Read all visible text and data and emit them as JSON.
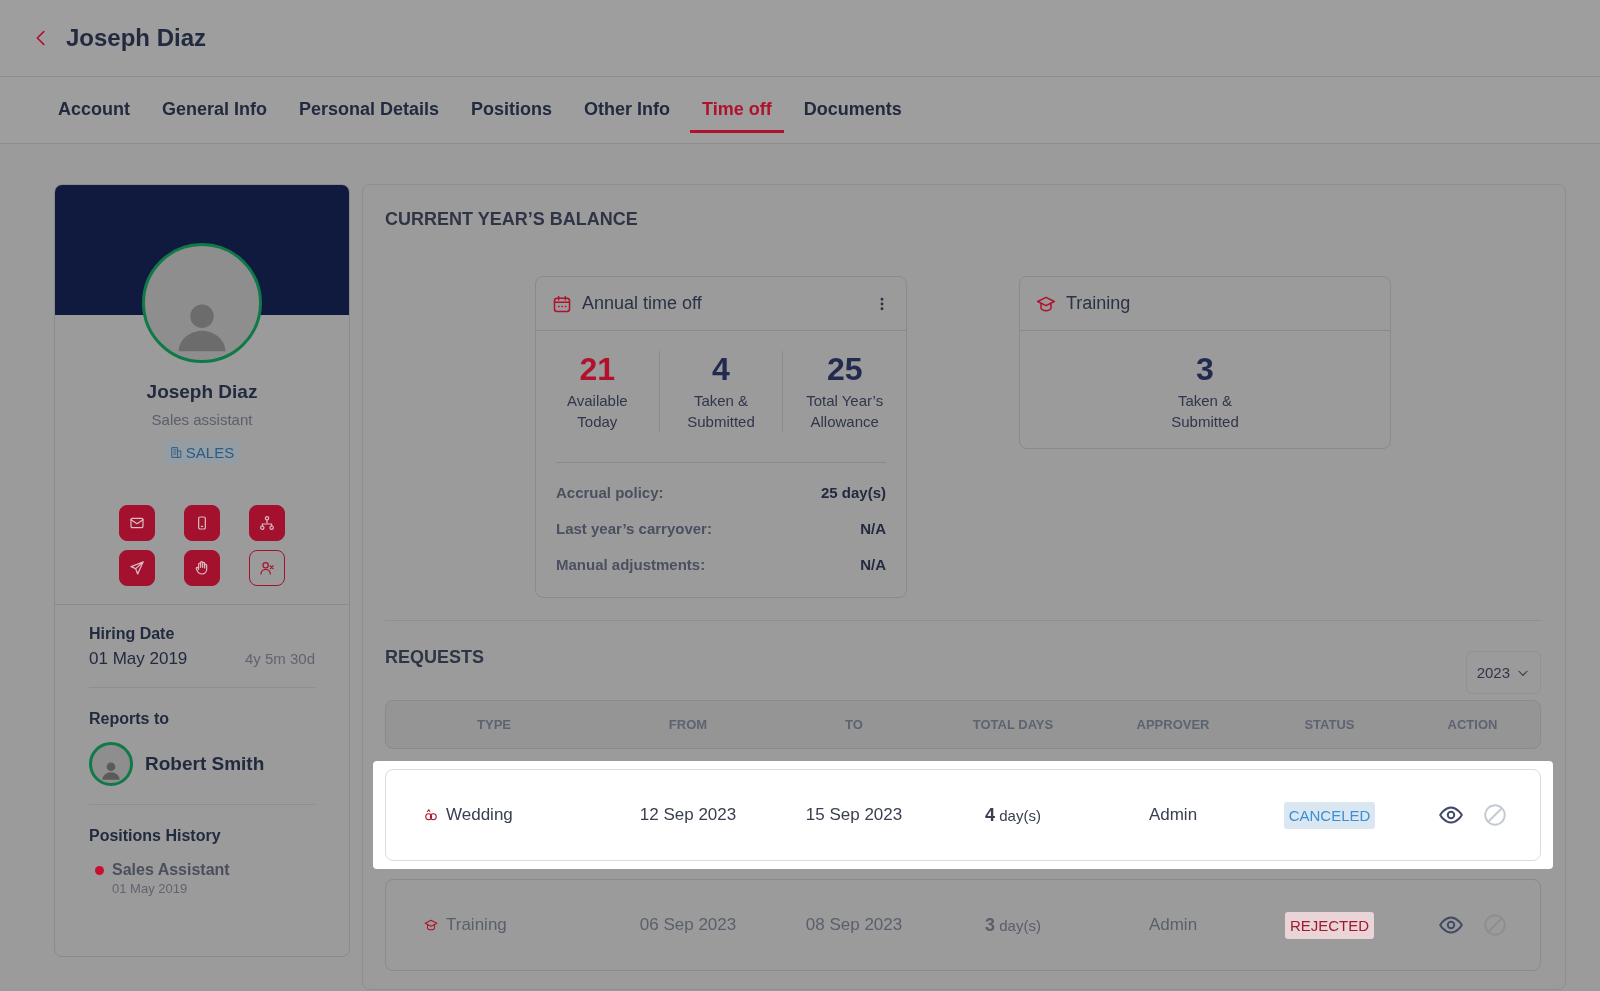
{
  "header": {
    "title": "Joseph Diaz"
  },
  "tabs": [
    {
      "label": "Account",
      "selected": false
    },
    {
      "label": "General Info",
      "selected": false
    },
    {
      "label": "Personal Details",
      "selected": false
    },
    {
      "label": "Positions",
      "selected": false
    },
    {
      "label": "Other Info",
      "selected": false
    },
    {
      "label": "Time off",
      "selected": true
    },
    {
      "label": "Documents",
      "selected": false
    }
  ],
  "profile": {
    "name": "Joseph Diaz",
    "role": "Sales assistant",
    "department": "SALES",
    "actions": [
      {
        "kind": "mail",
        "filled": true
      },
      {
        "kind": "phone",
        "filled": true
      },
      {
        "kind": "org",
        "filled": true
      },
      {
        "kind": "send",
        "filled": true
      },
      {
        "kind": "hand",
        "filled": true
      },
      {
        "kind": "user-remove",
        "filled": false
      }
    ],
    "hiring_label": "Hiring Date",
    "hiring_date": "01 May 2019",
    "tenure": "4y 5m 30d",
    "reports_label": "Reports to",
    "manager": "Robert Smith",
    "history_label": "Positions History",
    "history": [
      {
        "title": "Sales Assistant",
        "date": "01 May 2019",
        "color": "#c8102e"
      }
    ]
  },
  "balance": {
    "title": "CURRENT YEAR’S BALANCE",
    "cards": [
      {
        "kind": "annual",
        "title": "Annual time off",
        "menu": true,
        "stats": [
          {
            "value": "21",
            "label": "Available Today",
            "highlight": true
          },
          {
            "value": "4",
            "label": "Taken & Submitted",
            "highlight": false
          },
          {
            "value": "25",
            "label": "Total Year’s Allowance",
            "highlight": false
          }
        ],
        "details": [
          {
            "label": "Accrual policy:",
            "value": "25 day(s)"
          },
          {
            "label": "Last year’s carryover:",
            "value": "N/A"
          },
          {
            "label": "Manual adjustments:",
            "value": "N/A"
          }
        ]
      },
      {
        "kind": "training",
        "title": "Training",
        "menu": false,
        "stats": [
          {
            "value": "3",
            "label": "Taken & Submitted",
            "highlight": false
          }
        ]
      }
    ]
  },
  "requests": {
    "title": "REQUESTS",
    "year": "2023",
    "columns": [
      "TYPE",
      "FROM",
      "TO",
      "TOTAL DAYS",
      "APPROVER",
      "STATUS",
      "ACTION"
    ],
    "rows": [
      {
        "kind": "wedding",
        "type": "Wedding",
        "from": "12 Sep 2023",
        "to": "15 Sep 2023",
        "days": "4",
        "unit": "day(s)",
        "approver": "Admin",
        "status": {
          "text": "CANCELED",
          "color": "#3a8fd6"
        },
        "highlighted": true
      },
      {
        "kind": "training",
        "type": "Training",
        "from": "06 Sep 2023",
        "to": "08 Sep 2023",
        "days": "3",
        "unit": "day(s)",
        "approver": "Admin",
        "status": {
          "text": "REJECTED",
          "color": "#a2192e"
        },
        "highlighted": false
      }
    ]
  }
}
